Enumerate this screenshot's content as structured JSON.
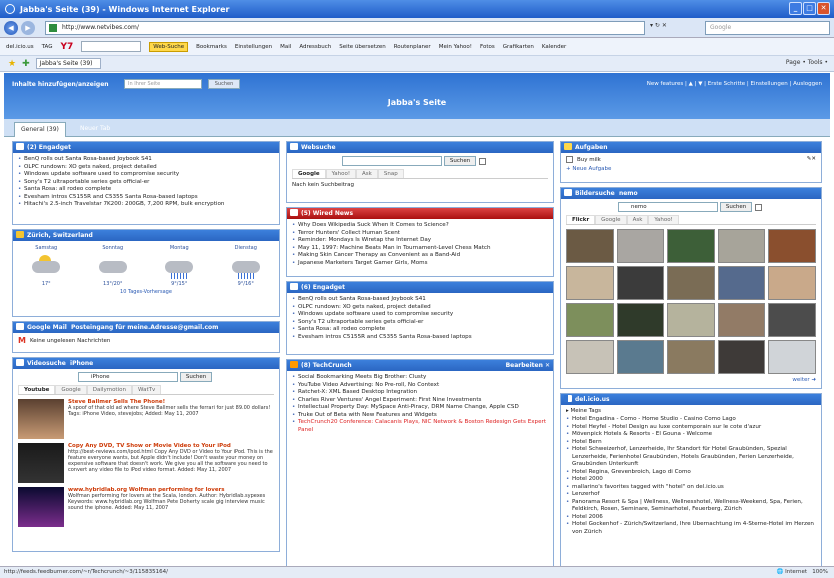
{
  "window": {
    "title": "Jabba's Seite (39) - Windows Internet Explorer"
  },
  "address": {
    "url": "http://www.netvibes.com/",
    "search_placeholder": "Google"
  },
  "toolbar2": {
    "site": "del.icio.us",
    "tag": "TAG",
    "yahoo": "Y7",
    "websuche": "Web-Suche",
    "items": [
      "Bookmarks",
      "Einstellungen",
      "Mail",
      "Adressbuch",
      "Seite übersetzen",
      "Routenplaner",
      "Mein Yahoo!",
      "Fotos",
      "Grafikarten",
      "Kalender"
    ]
  },
  "toolbar3": {
    "tab": "Jabba's Seite (39)",
    "right": "Page • Tools •"
  },
  "netvibes": {
    "add_content": "Inhalte hinzufügen/anzeigen",
    "search_placeholder": "In Ihrer Seite",
    "search_btn": "Suchen",
    "page_title": "Jabba's Seite",
    "right_links": "New features | ▲ | ▼ | Erste Schritte | Einstellungen | Ausloggen",
    "tabs": {
      "active": "General (39)",
      "new": "Neuer Tab"
    }
  },
  "col1": {
    "engadget": {
      "title": "(2) Engadget",
      "items": [
        "BenQ rolls out Santa Rosa-based Joybook S41",
        "OLPC rundown: XO gets naked, project detailed",
        "Windows update software used to compromise security",
        "Sony's T2 ultraportable series gets official-er",
        "Santa Rosa: all rodeo complete",
        "Evesham intros C5155R and C5355 Santa Rosa-based laptops",
        "Hitachi's 2.5-inch Travelstar 7K200: 200GB, 7,200 RPM, bulk encryption"
      ]
    },
    "weather": {
      "title": "Zürich, Switzerland",
      "days": [
        {
          "day": "Samstag",
          "temp": "17°"
        },
        {
          "day": "Sonntag",
          "temp": "13°/20°"
        },
        {
          "day": "Montag",
          "temp": "9°/15°"
        },
        {
          "day": "Dienstag",
          "temp": "9°/16°"
        }
      ],
      "link": "10 Tages-Vorhersage"
    },
    "gmail": {
      "title": "Google Mail",
      "account": "Posteingang für meine.Adresse@gmail.com",
      "text": "Keine ungelesen Nachrichten"
    },
    "video": {
      "title": "Videosuche",
      "query": "iPhone",
      "query_label": "iPhone",
      "btn": "Suchen",
      "tabs": [
        "Youtube",
        "Google",
        "Dailymotion",
        "WatTv"
      ],
      "items": [
        {
          "title": "Steve Ballmer Sells The Phone!",
          "text": "A spoof of that old ad where Steve Ballmer sells the ferrari for just 89.00 dollars! Tags: iPhone Video, stevejobs; Added: May 11, 2007"
        },
        {
          "title": "Copy Any DVD, TV Show or Movie Video to Your iPod",
          "text": "http://best-reviews.com/ipod.html Copy Any DVD or Video to Your iPod. This is the feature everyone wants, but Apple didn't include! Don't waste your money on expensive software that doesn't work. We give you all the software you need to convert any video file to iPod video format. Added: May 11, 2007"
        },
        {
          "title": "www.hybridlab.org Wolfman performing for lovers",
          "text": "Wolfman performing for lovers at the Scala, london. Author: Hybridlab.sypexes Keywords: www.hybridlab.org Wolfman Pete Doherty scale gig interview music sound the iphone. Added: May 11, 2007"
        }
      ]
    }
  },
  "col2": {
    "websuche": {
      "title": "Websuche",
      "btn": "Suchen",
      "tabs": [
        "Google",
        "Yahoo!",
        "Ask",
        "Snap"
      ],
      "text": "Nach kein Suchbeitrag"
    },
    "wired": {
      "title": "(5) Wired News",
      "items": [
        "Why Does Wikipedia Suck When It Comes to Science?",
        "Terror Hunters' Collect Human Scent",
        "Reminder: Mondays Is Wiretap the Internet Day",
        "May 11, 1997: Machine Beats Man in Tournament-Level Chess Match",
        "Making Skin Cancer Therapy as Convenient as a Band-Aid",
        "Japanese Marketers Target Gamer Girls, Moms"
      ]
    },
    "engadget2": {
      "title": "(6) Engadget",
      "items": [
        "BenQ rolls out Santa Rosa-based Joybook S41",
        "OLPC rundown: XO gets naked, project detailed",
        "Windows update software used to compromise security",
        "Sony's T2 ultraportable series gets official-er",
        "Santa Rosa: all rodeo complete",
        "Evesham intros C5155R and C5355 Santa Rosa-based laptops"
      ]
    },
    "techcrunch": {
      "title": "(8) TechCrunch",
      "ctrl": "Bearbeiten ✕",
      "items": [
        "Social Bookmarking Meets Big Brother: Clusty",
        "YouTube Video Advertising: No Pre-roll, No Context",
        "Ratchet-X: XML Based Desktop Integration",
        "Charles River Ventures' Angel Experiment: First Nine Investments",
        "Intellectual Property Day: MySpace Anti-Piracy, DRM Name Change, Apple CSD",
        "Truke Out of Beta with New Features and Widgets",
        "TechCrunch20 Conference: Calacanis Plays, NIC Network & Boston Redesign Gets Expert Panel"
      ]
    }
  },
  "col3": {
    "tasks": {
      "title": "Aufgaben",
      "item": "Buy milk",
      "new": "Neue Aufgabe"
    },
    "photo": {
      "title": "Bildersuche",
      "query": "nemo",
      "query_value": "nemo",
      "btn": "Suchen",
      "tabs": [
        "Flickr",
        "Google",
        "Ask",
        "Yahoo!"
      ],
      "more": "weiter",
      "tile_colors": [
        "#6b5a44",
        "#a9a6a2",
        "#3d5f38",
        "#a7a49a",
        "#8a4f2e",
        "#c8b69c",
        "#3b3b3b",
        "#7a6c55",
        "#556a8d",
        "#c9a98a",
        "#7d8f5c",
        "#2f3a2a",
        "#b5b39d",
        "#927b66",
        "#4c4c4c",
        "#c7c2b7",
        "#5a7a8f",
        "#8a7a60",
        "#3e3a38",
        "#d0d4d8"
      ]
    },
    "delicious": {
      "title": "del.icio.us",
      "sub": "Meine Tags",
      "items": [
        "Hotel Engadina - Como - Home Studio - Casino Como Lago",
        "Hotel Heyfel - Hotel Design au luxe contemporain sur le cote d'azur",
        "Mövenpick Hotels & Resorts - El Gouna - Welcome",
        "Hotel Bern",
        "Hotel Schweizerhof, Lenzerheide, Ihr Standort für Hotel Graubünden, Spezial Lenzerheide, Ferienhotel Graubünden, Hotels Graubünden, Ferien Lenzerheide, Graubünden Unterkunft",
        "Hotel Regina, Grevenbroich, Lago di Como",
        "Hotel 2000",
        "mallarino's favorites tagged with \"hotel\" on del.icio.us",
        "Lenzerhof",
        "Panorama Resort & Spa | Wellness, Wellnesshotel, Wellness-Weekend, Spa, Ferien, Feldkirch, Rosen, Seminare, Seminarhotel, Feuerberg, Zürich",
        "Hotel 2006",
        "Hotel Gockenhof - Zürich/Switzerland, Ihre Übernachtung im 4-Sterne-Hotel im Herzen von Zürich"
      ]
    }
  },
  "status": {
    "text": "http://feeds.feedburner.com/~r/Techcrunch/~3/115835164/",
    "zone": "Internet",
    "zoom": "100%"
  }
}
